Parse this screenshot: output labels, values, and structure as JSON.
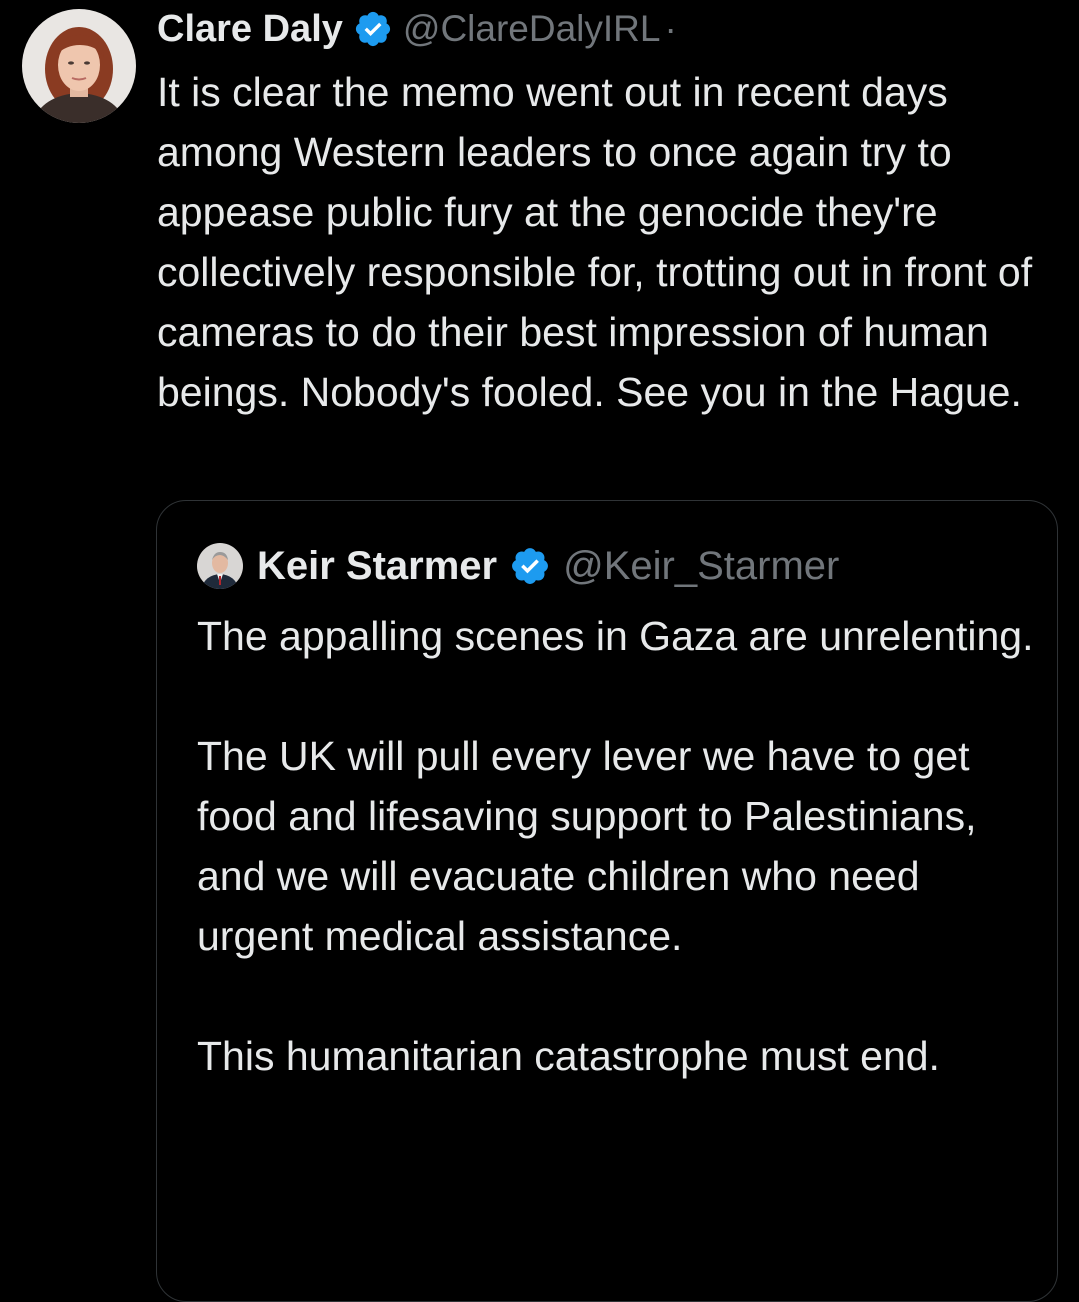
{
  "tweet": {
    "author": {
      "display_name": "Clare Daly",
      "handle": "@ClareDalyIRL",
      "separator": "·",
      "avatar_icon": "profile-photo",
      "verified_icon": "verified-badge-icon"
    },
    "text": "It is clear the memo went out in recent days among Western leaders to once again try to appease public fury at the genocide they're collectively responsible for, trotting out in front of cameras to do their best impression of human beings. Nobody's fooled. See you in the Hague."
  },
  "quoted_tweet": {
    "author": {
      "display_name": "Keir Starmer",
      "handle": "@Keir_Starmer",
      "avatar_icon": "profile-photo",
      "verified_icon": "verified-badge-icon"
    },
    "paragraphs": [
      "The appalling scenes in Gaza are unrelenting.",
      "The UK will pull every lever we have to get food and lifesaving support to Palestinians, and we will evacuate children who need urgent medical assistance.",
      "This humanitarian catastrophe must end."
    ]
  },
  "colors": {
    "background": "#000000",
    "text_primary": "#e7e9ea",
    "text_secondary": "#71767b",
    "verified_blue": "#1d9bf0",
    "border": "#2f3336"
  }
}
